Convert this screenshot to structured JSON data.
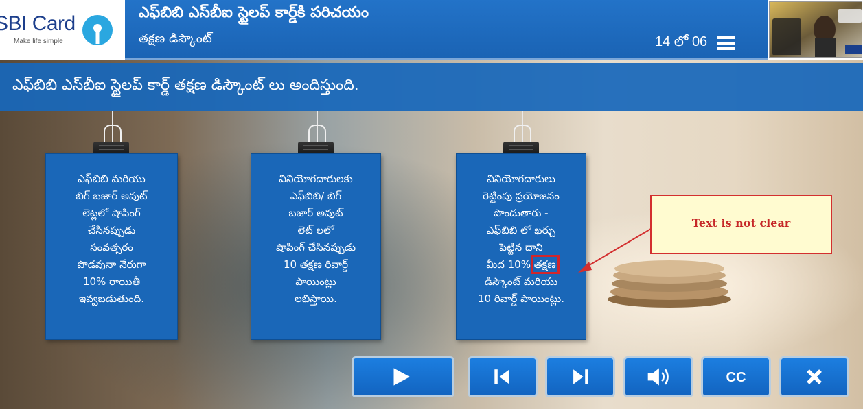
{
  "header": {
    "logo_text": "SBI Card",
    "logo_tagline": "Make life simple",
    "course_title": "ఎఫ్‌బిబి ఎస్‌బీఐ స్టైలప్ కార్డ్‌కి పరిచయం",
    "slide_subtitle": "తక్షణ డిస్కౌంట్",
    "page_counter": "14 లో 06",
    "menu_icon": "hamburger-icon",
    "thumbnail_icon": "credit-card-promo-image"
  },
  "slide": {
    "headline": "ఎఫ్‌బిబి ఎస్‌బీఐ స్టైలప్ కార్డ్ తక్షణ డిస్కౌంట్ లు అందిస్తుంది.",
    "cards": [
      {
        "lines": [
          "ఎఫ్‌బిబి మరియు",
          "బిగ్ బజార్ అవుట్",
          "లెట్లలో షాపింగ్",
          "చేసినప్పుడు",
          "సంవత్సరం",
          "పొడవునా నేరుగా",
          "10% రాయితీ",
          "ఇవ్వబడుతుంది."
        ]
      },
      {
        "lines": [
          "వినియోగదారులకు",
          "ఎఫ్‌బిబి/ బిగ్",
          "బజార్ అవుట్",
          "లెట్ లలో",
          "షాపింగ్ చేసినప్పుడు",
          "10 తక్షణ రివార్డ్",
          "పాయింట్లు",
          "లభిస్తాయి."
        ]
      },
      {
        "lines": [
          "వినియోగదారులు",
          "రెట్టింపు ప్రయోజనం",
          "పొందుతారు -",
          "ఎఫ్‌బిబి లో ఖర్చు",
          "పెట్టిన దాని",
          "మీద 10%",
          "డిస్కౌంట్ మరియు",
          "10 రివార్డ్ పాయింట్లు."
        ],
        "highlighted_word": "తక్షణ"
      }
    ]
  },
  "annotation": {
    "text": "Text is not clear",
    "border_color": "#d32f2f",
    "background_color": "#fffbd0"
  },
  "controls": {
    "play_icon": "play-icon",
    "prev_icon": "skip-previous-icon",
    "next_icon": "skip-next-icon",
    "volume_icon": "volume-icon",
    "cc_label": "CC",
    "close_icon": "close-icon"
  },
  "colors": {
    "brand_blue": "#1a67b8",
    "header_blue": "#2373c8",
    "button_blue": "#1c7ee0"
  }
}
